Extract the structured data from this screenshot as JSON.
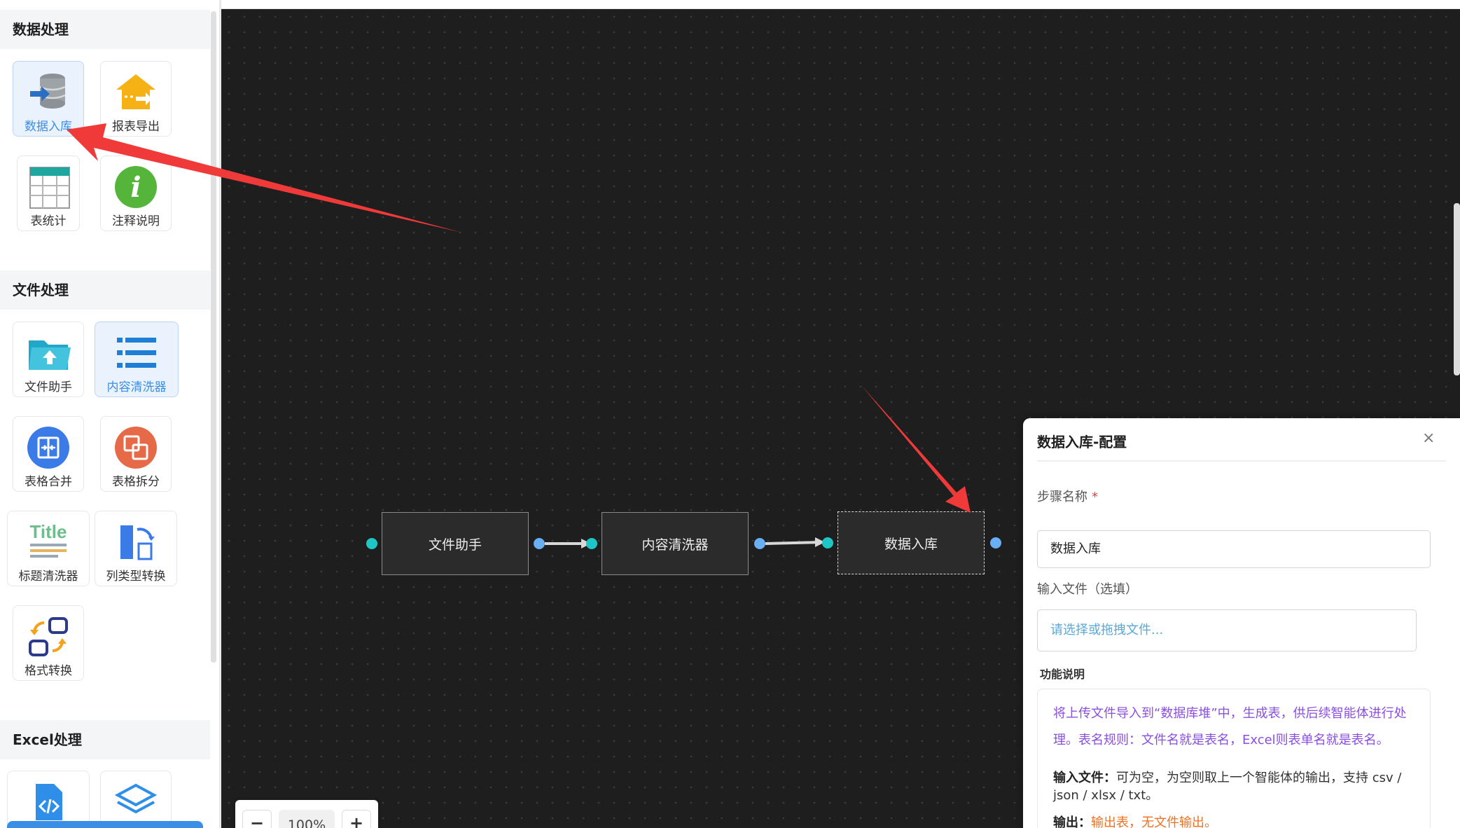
{
  "sidebar": {
    "sections": [
      {
        "title": "数据处理"
      },
      {
        "title": "文件处理"
      },
      {
        "title": "Excel处理"
      }
    ],
    "tools": {
      "db_import": "数据入库",
      "report_export": "报表导出",
      "table_stats": "表统计",
      "comment": "注释说明",
      "file_helper": "文件助手",
      "content_cleaner": "内容清洗器",
      "table_merge": "表格合并",
      "table_split": "表格拆分",
      "title_cleaner": "标题清洗器",
      "col_type_convert": "列类型转换",
      "format_convert": "格式转换"
    },
    "icons": {
      "db_import": "database-import-icon",
      "report_export": "house-export-icon",
      "table_stats": "table-grid-icon",
      "comment": "info-icon",
      "file_helper": "folder-upload-icon",
      "content_cleaner": "list-icon",
      "table_merge": "merge-icon",
      "table_split": "split-icon",
      "title_cleaner": "title-icon",
      "col_type_convert": "column-convert-icon",
      "format_convert": "format-convert-icon",
      "code": "code-file-icon",
      "layers": "layers-icon"
    }
  },
  "canvas": {
    "nodes": [
      {
        "label": "文件助手"
      },
      {
        "label": "内容清洗器"
      },
      {
        "label": "数据入库"
      }
    ],
    "zoom": {
      "minus": "−",
      "level": "100%",
      "plus": "+"
    }
  },
  "panel": {
    "title": "数据入库-配置",
    "close": "×",
    "step_name_label": "步骤名称",
    "required_mark": "*",
    "step_name_value": "数据入库",
    "input_file_label": "输入文件（选填）",
    "input_file_placeholder": "请选择或拖拽文件...",
    "desc_title": "功能说明",
    "desc_text": "将上传文件导入到“数据库堆”中，生成表，供后续智能体进行处理。表名规则：文件名就是表名，Excel则表单名就是表名。",
    "input_file_key": "输入文件",
    "input_file_desc": "可为空，为空则取上一个智能体的输出，支持 csv / json / xlsx / txt。",
    "output_key": "输出",
    "output_desc": "输出表，无文件输出。"
  },
  "colors": {
    "accent": "#3a8ee6",
    "canvas_bg": "#1e1e1e",
    "port_in": "#1fc6c6",
    "port_out": "#6aaef4",
    "arrow": "#f03a3a",
    "desc_purple": "#8a4fe0"
  }
}
